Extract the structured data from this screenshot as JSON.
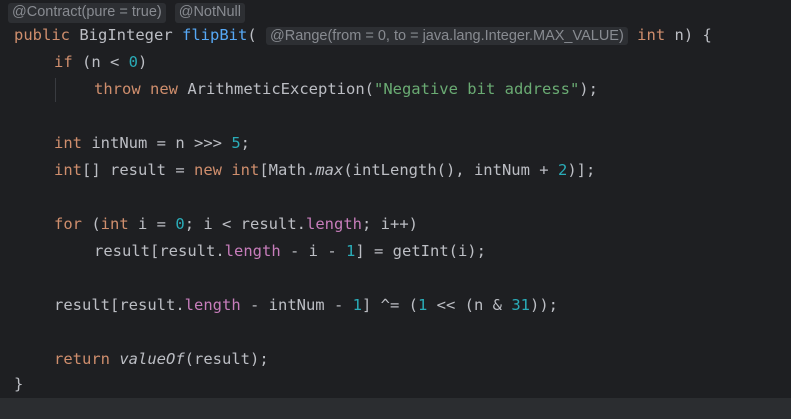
{
  "hints": {
    "contract": "@Contract(pure = true)",
    "notnull": "@NotNull",
    "range": "@Range(from = 0, to = java.lang.Integer.MAX_VALUE)"
  },
  "code": {
    "l1": {
      "public": "public",
      "type": "BigInteger",
      "name": "flipBit",
      "open": "(",
      "int": "int",
      "rest": " n) {"
    },
    "l2": {
      "if": "if",
      "a": " (n < ",
      "n0": "0",
      "b": ")"
    },
    "l3": {
      "throw": "throw",
      "new": "new",
      "a": " ArithmeticException(",
      "str": "\"Negative bit address\"",
      "b": ");"
    },
    "l4": {
      "int": "int",
      "a": " intNum = n >>> ",
      "n5": "5",
      "b": ";"
    },
    "l5": {
      "int": "int",
      "a": "[] result = ",
      "new": "new",
      "int2": "int",
      "b": "[Math.",
      "max": "max",
      "c": "(intLength(), intNum + ",
      "n2": "2",
      "d": ")];"
    },
    "l6": {
      "for": "for",
      "a": " (",
      "int": "int",
      "b": " i = ",
      "n0": "0",
      "c": "; i < result.",
      "length": "length",
      "d": "; i++)"
    },
    "l7": {
      "a": "result[result.",
      "length": "length",
      "b": " - i - ",
      "n1": "1",
      "c": "] = getInt(i);"
    },
    "l8": {
      "a": "result[result.",
      "length": "length",
      "b": " - intNum - ",
      "n1": "1",
      "c": "] ^= (",
      "n1b": "1",
      "d": " << (n & ",
      "n31": "31",
      "e": "));"
    },
    "l9": {
      "return": "return",
      "a": " ",
      "valueOf": "valueOf",
      "b": "(result);"
    },
    "l10": {
      "close": "}"
    }
  }
}
